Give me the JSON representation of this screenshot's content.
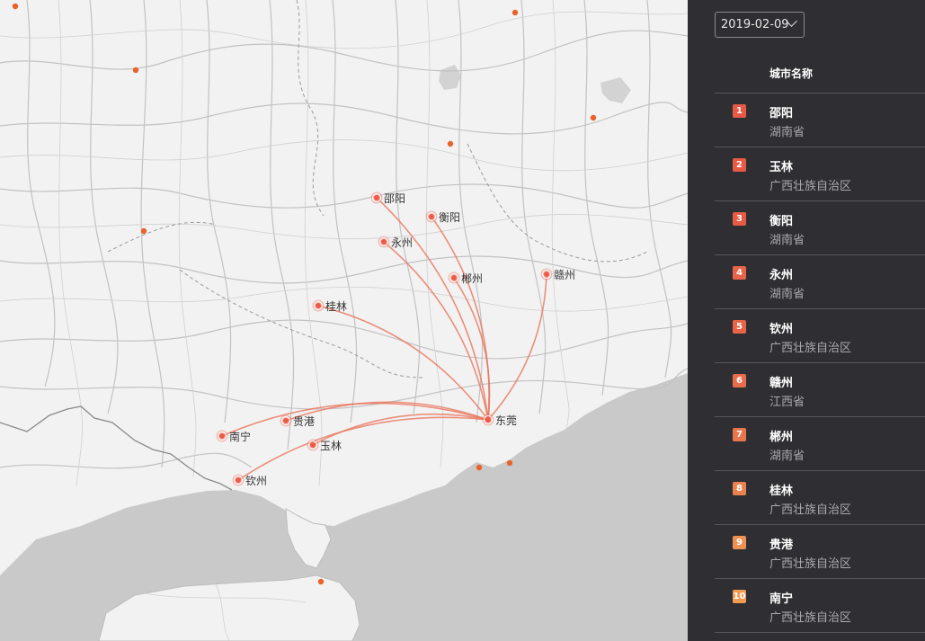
{
  "map": {
    "destination": "东莞",
    "colors": {
      "flow": "#e8765d",
      "node": "#ee5a45",
      "land": "#f2f2f2",
      "sea": "#c9c9c9",
      "road": "#bdbdbd",
      "border": "#8a8a8a"
    },
    "origins": [
      "邵阳",
      "衡阳",
      "永州",
      "郴州",
      "赣州",
      "桂林",
      "贵港",
      "南宁",
      "玉林",
      "钦州"
    ]
  },
  "panel": {
    "date": "2019-02-09",
    "column_header": "城市名称",
    "ranking": [
      {
        "rank": "1",
        "city": "邵阳",
        "province": "湖南省",
        "color": "#e85a45"
      },
      {
        "rank": "2",
        "city": "玉林",
        "province": "广西壮族自治区",
        "color": "#e85a45"
      },
      {
        "rank": "3",
        "city": "衡阳",
        "province": "湖南省",
        "color": "#e85a45"
      },
      {
        "rank": "4",
        "city": "永州",
        "province": "湖南省",
        "color": "#e86448"
      },
      {
        "rank": "5",
        "city": "钦州",
        "province": "广西壮族自治区",
        "color": "#e86448"
      },
      {
        "rank": "6",
        "city": "赣州",
        "province": "江西省",
        "color": "#e86c4a"
      },
      {
        "rank": "7",
        "city": "郴州",
        "province": "湖南省",
        "color": "#e8754c"
      },
      {
        "rank": "8",
        "city": "桂林",
        "province": "广西壮族自治区",
        "color": "#ea8250"
      },
      {
        "rank": "9",
        "city": "贵港",
        "province": "广西壮族自治区",
        "color": "#ec9053"
      },
      {
        "rank": "10",
        "city": "南宁",
        "province": "广西壮族自治区",
        "color": "#ef9c55"
      }
    ]
  }
}
